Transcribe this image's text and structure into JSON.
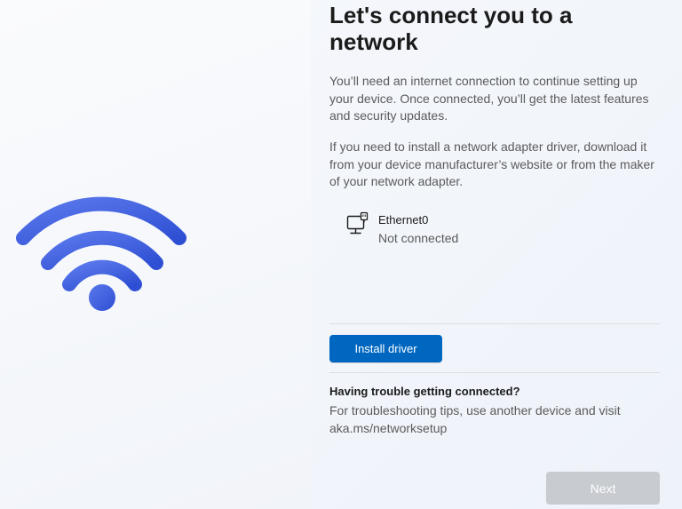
{
  "page": {
    "title": "Let's connect you to a network",
    "paragraph_1": "You’ll need an internet connection to continue setting up your device. Once connected, you’ll get the latest features and security updates.",
    "paragraph_2": "If you need to install a network adapter driver, download it from your device manufacturer’s website or from the maker of your network adapter."
  },
  "network": {
    "icon": "ethernet-icon",
    "name": "Ethernet0",
    "status": "Not connected"
  },
  "actions": {
    "install_driver_label": "Install driver",
    "next_label": "Next"
  },
  "troubleshoot": {
    "heading": "Having trouble getting connected?",
    "text": "For troubleshooting tips, use another device and visit aka.ms/networksetup"
  },
  "illustration": {
    "icon": "wifi-icon",
    "colors": [
      "#4f6be6",
      "#3d5fe0",
      "#2f53d6"
    ]
  },
  "colors": {
    "accent": "#0067c0",
    "disabled_button": "#c8cbd0",
    "secondary_text": "#5a5a5a"
  }
}
